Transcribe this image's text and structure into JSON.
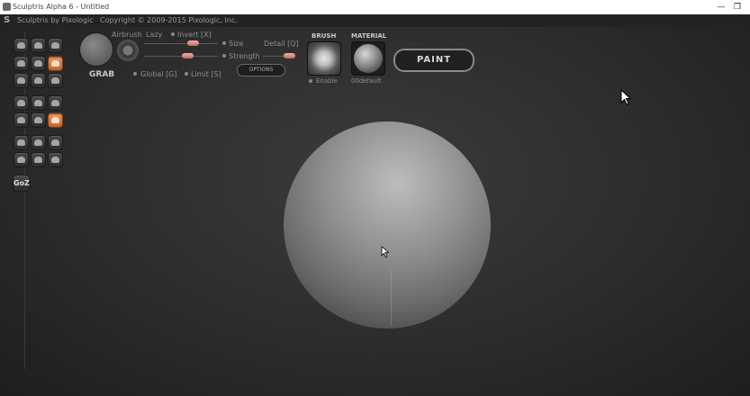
{
  "window": {
    "title": "Sculptris Alpha 6 - Untitled",
    "minimize_glyph": "—",
    "maximize_glyph": "❐"
  },
  "app_header": {
    "logo_glyph": "S",
    "brand": "Sculptris by Pixologic",
    "copyright": "Copyright © 2009-2015 Pixologic, Inc."
  },
  "tools": {
    "gz_label": "GoZ",
    "active_color": "#e07a3a"
  },
  "brush_panel": {
    "mode_name": "GRAB",
    "airbrush_label": "Airbrush",
    "lazy_label": "Lazy",
    "invert_label": "Invert [X]",
    "size_label": "Size",
    "detail_label": "Detail [Q]",
    "strength_label": "Strength",
    "options_label": "OPTIONS",
    "global_label": "Global [G]",
    "limit_label": "Limit [S]"
  },
  "brush": {
    "heading": "BRUSH",
    "enable_label": "Enable"
  },
  "material": {
    "heading": "MATERIAL",
    "name": "00default"
  },
  "paint_button_label": "PAINT",
  "colors": {
    "viewport_bg": "#2f2f2f",
    "sphere": "#9a9a9a",
    "accent": "#e07a3a"
  }
}
